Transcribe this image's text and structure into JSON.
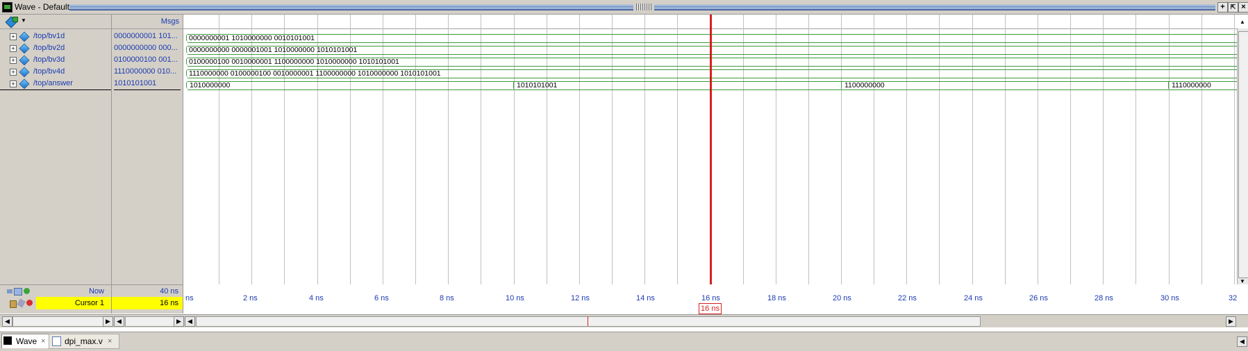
{
  "window": {
    "title": "Wave - Default"
  },
  "panes": {
    "name_header": "Msgs"
  },
  "signals": [
    {
      "name": "/top/bv1d",
      "value": "0000000001 101..."
    },
    {
      "name": "/top/bv2d",
      "value": "0000000000 000..."
    },
    {
      "name": "/top/bv3d",
      "value": "0100000100 001..."
    },
    {
      "name": "/top/bv4d",
      "value": "1110000000 010..."
    },
    {
      "name": "/top/answer",
      "value": "1010101001"
    }
  ],
  "waves": {
    "bv1d": "0000000001 1010000000 0010101001",
    "bv2d": "0000000000 0000001001 1010000000 1010101001",
    "bv3d": "0100000100 0010000001 1100000000 1010000000 1010101001",
    "bv4d": "1110000000 0100000100 0010000001 1100000000 1010000000 1010101001",
    "answer_segments": [
      "1010000000",
      "1010101001",
      "1100000000",
      "1110000000"
    ]
  },
  "footer": {
    "now_label": "Now",
    "now_value": "40 ns",
    "cursor_label": "Cursor 1",
    "cursor_value": "16 ns",
    "cursor_flag": "16 ns"
  },
  "timeline": {
    "first_label": "ns",
    "labels": [
      "2 ns",
      "4 ns",
      "6 ns",
      "8 ns",
      "10 ns",
      "12 ns",
      "14 ns",
      "16 ns",
      "18 ns",
      "20 ns",
      "22 ns",
      "24 ns",
      "26 ns",
      "28 ns",
      "30 ns",
      "32"
    ]
  },
  "tabs": [
    {
      "label": "Wave"
    },
    {
      "label": "dpi_max.v"
    }
  ],
  "colors": {
    "accent": "#1a3ab0",
    "cursor": "#d42020",
    "wave": "#3a9a3a",
    "highlight": "#ffff00"
  }
}
